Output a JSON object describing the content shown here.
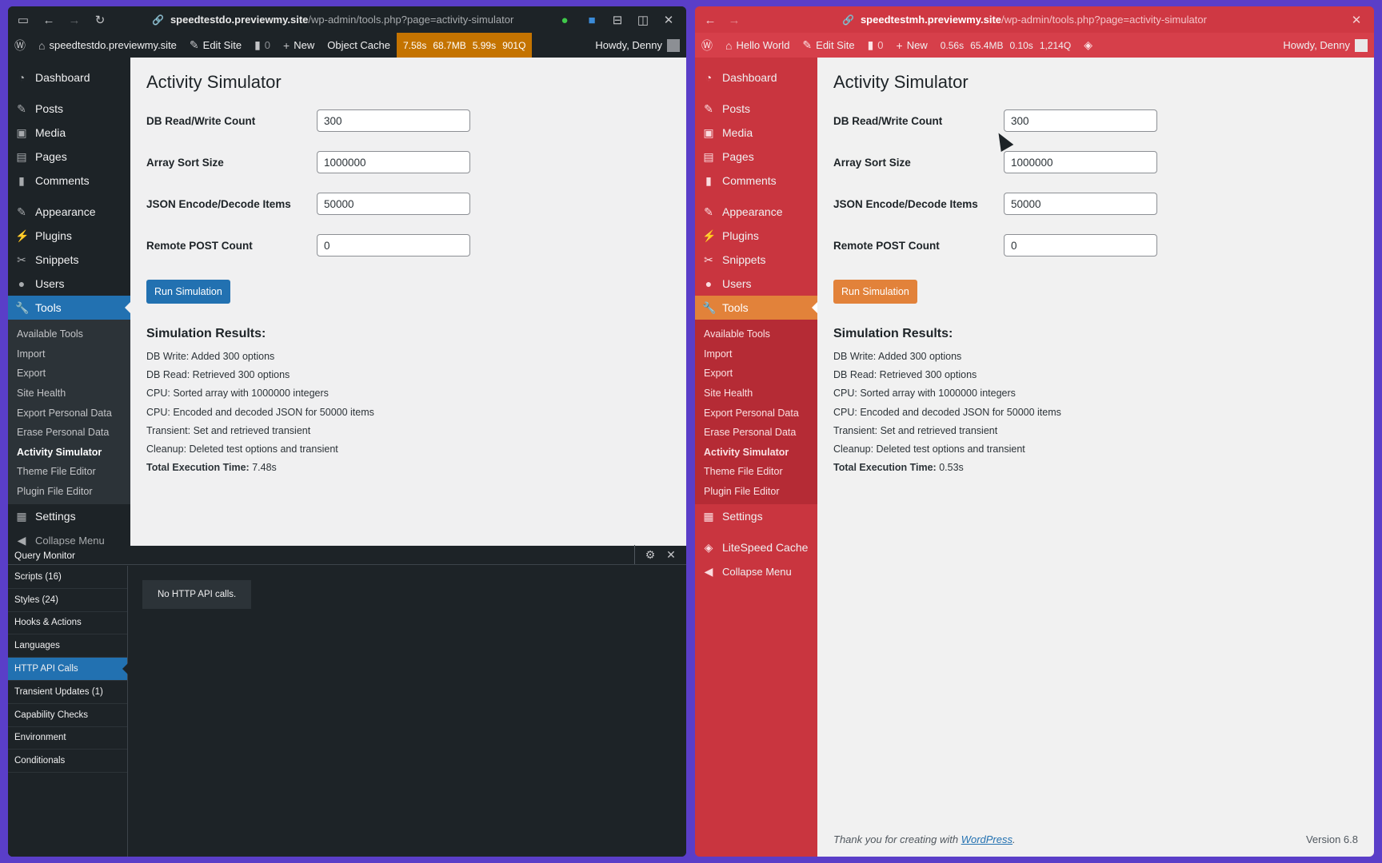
{
  "left": {
    "url_domain": "speedtestdo.previewmy.site",
    "url_path": "/wp-admin/tools.php?page=activity-simulator",
    "site_name": "speedtestdo.previewmy.site",
    "edit_site": "Edit Site",
    "comments_count": "0",
    "new_label": "New",
    "object_cache": "Object Cache",
    "perf": {
      "time": "7.58s",
      "mem": "68.7MB",
      "db_time": "5.99s",
      "queries": "901Q"
    },
    "howdy": "Howdy, Denny",
    "menu": {
      "dashboard": "Dashboard",
      "posts": "Posts",
      "media": "Media",
      "pages": "Pages",
      "comments": "Comments",
      "appearance": "Appearance",
      "plugins": "Plugins",
      "snippets": "Snippets",
      "users": "Users",
      "tools": "Tools",
      "settings": "Settings",
      "collapse": "Collapse Menu"
    },
    "tools_sub": [
      "Available Tools",
      "Import",
      "Export",
      "Site Health",
      "Export Personal Data",
      "Erase Personal Data",
      "Activity Simulator",
      "Theme File Editor",
      "Plugin File Editor"
    ],
    "title": "Activity Simulator",
    "fields": [
      {
        "label": "DB Read/Write Count",
        "value": "300"
      },
      {
        "label": "Array Sort Size",
        "value": "1000000"
      },
      {
        "label": "JSON Encode/Decode Items",
        "value": "50000"
      },
      {
        "label": "Remote POST Count",
        "value": "0"
      }
    ],
    "run_button": "Run Simulation",
    "results_title": "Simulation Results:",
    "results": [
      "DB Write: Added 300 options",
      "DB Read: Retrieved 300 options",
      "CPU: Sorted array with 1000000 integers",
      "CPU: Encoded and decoded JSON for 50000 items",
      "Transient: Set and retrieved transient",
      "Cleanup: Deleted test options and transient"
    ],
    "total_label": "Total Execution Time:",
    "total_value": "7.48s",
    "query_monitor": {
      "title": "Query Monitor",
      "nav": [
        "Scripts (16)",
        "Styles (24)",
        "Hooks & Actions",
        "Languages",
        "HTTP API Calls",
        "Transient Updates (1)",
        "Capability Checks",
        "Environment",
        "Conditionals"
      ],
      "active": "HTTP API Calls",
      "message": "No HTTP API calls."
    }
  },
  "right": {
    "url_domain": "speedtestmh.previewmy.site",
    "url_path": "/wp-admin/tools.php?page=activity-simulator",
    "site_name": "Hello World",
    "edit_site": "Edit Site",
    "comments_count": "0",
    "new_label": "New",
    "perf": {
      "time": "0.56s",
      "mem": "65.4MB",
      "db_time": "0.10s",
      "queries": "1,214Q"
    },
    "howdy": "Howdy, Denny",
    "menu": {
      "dashboard": "Dashboard",
      "posts": "Posts",
      "media": "Media",
      "pages": "Pages",
      "comments": "Comments",
      "appearance": "Appearance",
      "plugins": "Plugins",
      "snippets": "Snippets",
      "users": "Users",
      "tools": "Tools",
      "settings": "Settings",
      "litespeed": "LiteSpeed Cache",
      "collapse": "Collapse Menu"
    },
    "tools_sub": [
      "Available Tools",
      "Import",
      "Export",
      "Site Health",
      "Export Personal Data",
      "Erase Personal Data",
      "Activity Simulator",
      "Theme File Editor",
      "Plugin File Editor"
    ],
    "title": "Activity Simulator",
    "fields": [
      {
        "label": "DB Read/Write Count",
        "value": "300"
      },
      {
        "label": "Array Sort Size",
        "value": "1000000"
      },
      {
        "label": "JSON Encode/Decode Items",
        "value": "50000"
      },
      {
        "label": "Remote POST Count",
        "value": "0"
      }
    ],
    "run_button": "Run Simulation",
    "results_title": "Simulation Results:",
    "results": [
      "DB Write: Added 300 options",
      "DB Read: Retrieved 300 options",
      "CPU: Sorted array with 1000000 integers",
      "CPU: Encoded and decoded JSON for 50000 items",
      "Transient: Set and retrieved transient",
      "Cleanup: Deleted test options and transient"
    ],
    "total_label": "Total Execution Time:",
    "total_value": "0.53s",
    "footer_text": "Thank you for creating with",
    "footer_link": "WordPress",
    "version": "Version 6.8"
  },
  "colors": {
    "left_accent": "#2271b1",
    "right_accent": "#e2823a",
    "right_theme": "#c9353f",
    "perf_badge": "#c47300"
  }
}
